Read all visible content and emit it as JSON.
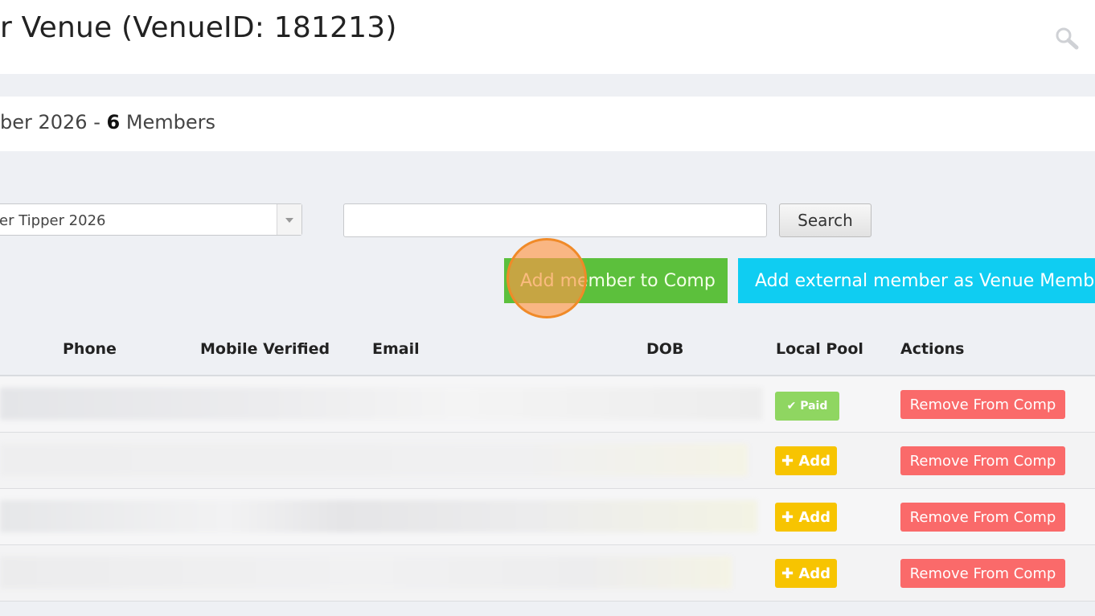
{
  "page": {
    "title": "r Venue (VenueID: 181213)"
  },
  "competition": {
    "name_fragment": "ber 2026 - ",
    "member_count": "6",
    "members_label": " Members"
  },
  "filters": {
    "comp_select_value": "er Tipper 2026",
    "search_value": "",
    "search_button_label": "Search"
  },
  "actions": {
    "add_member_label": "Add member to Comp",
    "add_external_label": "Add external member as Venue Member"
  },
  "table": {
    "columns": [
      "Phone",
      "Mobile Verified",
      "Email",
      "DOB",
      "Local Pool",
      "Actions"
    ],
    "rows": [
      {
        "local_pool": "Paid",
        "action": "Remove From Comp"
      },
      {
        "local_pool": "Add",
        "action": "Remove From Comp"
      },
      {
        "local_pool": "Add",
        "action": "Remove From Comp"
      },
      {
        "local_pool": "Add",
        "action": "Remove From Comp"
      }
    ]
  },
  "icons": {
    "header_search": "search-icon",
    "paid": "check-icon",
    "add": "plus-icon"
  },
  "colors": {
    "add_member_green": "#5cc03c",
    "add_external_cyan": "#0fcdf2",
    "paid_green": "#8fd661",
    "add_yellow": "#f7c401",
    "remove_red": "#fa6a6a"
  }
}
